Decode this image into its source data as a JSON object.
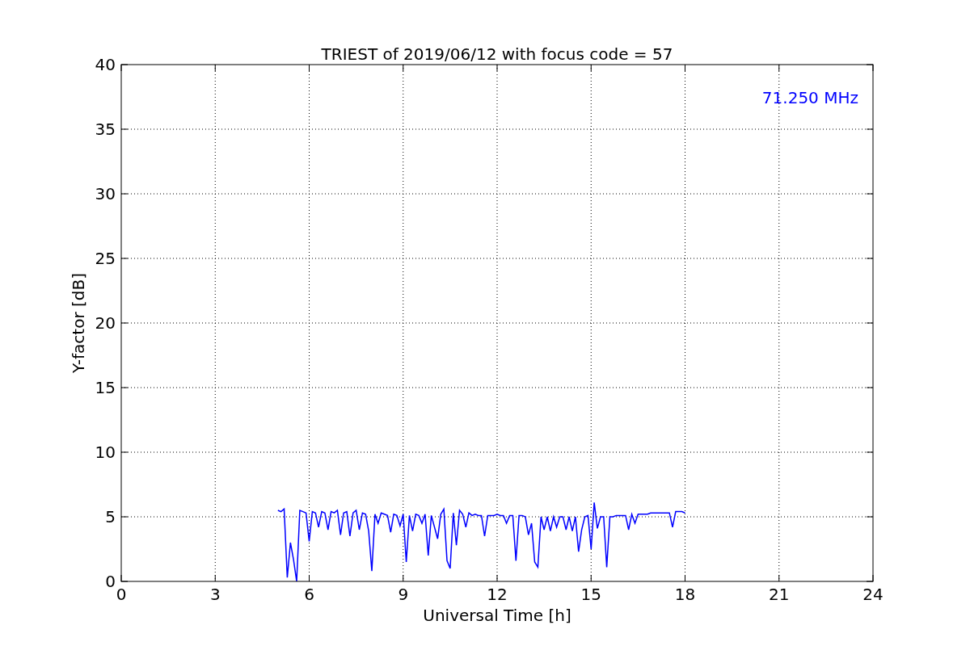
{
  "chart_data": {
    "type": "line",
    "title": "TRIEST of 2019/06/12 with focus code = 57",
    "xlabel": "Universal Time [h]",
    "ylabel": "Y-factor [dB]",
    "xlim": [
      0,
      24
    ],
    "ylim": [
      0,
      40
    ],
    "xticks": [
      0,
      3,
      6,
      9,
      12,
      15,
      18,
      21,
      24
    ],
    "yticks": [
      0,
      5,
      10,
      15,
      20,
      25,
      30,
      35,
      40
    ],
    "grid": true,
    "x": [
      5.0,
      5.1,
      5.2,
      5.3,
      5.4,
      5.5,
      5.6,
      5.7,
      5.8,
      5.9,
      6.0,
      6.1,
      6.2,
      6.3,
      6.4,
      6.5,
      6.6,
      6.7,
      6.8,
      6.9,
      7.0,
      7.1,
      7.2,
      7.3,
      7.4,
      7.5,
      7.6,
      7.7,
      7.8,
      7.9,
      8.0,
      8.1,
      8.2,
      8.3,
      8.4,
      8.5,
      8.6,
      8.7,
      8.8,
      8.9,
      9.0,
      9.1,
      9.2,
      9.3,
      9.4,
      9.5,
      9.6,
      9.7,
      9.8,
      9.9,
      10.0,
      10.1,
      10.2,
      10.3,
      10.4,
      10.5,
      10.6,
      10.7,
      10.8,
      10.9,
      11.0,
      11.1,
      11.2,
      11.3,
      11.4,
      11.5,
      11.6,
      11.7,
      11.8,
      11.9,
      12.0,
      12.1,
      12.2,
      12.3,
      12.4,
      12.5,
      12.6,
      12.7,
      12.8,
      12.9,
      13.0,
      13.1,
      13.2,
      13.3,
      13.4,
      13.5,
      13.6,
      13.7,
      13.8,
      13.9,
      14.0,
      14.1,
      14.2,
      14.3,
      14.4,
      14.5,
      14.6,
      14.7,
      14.8,
      14.9,
      15.0,
      15.1,
      15.2,
      15.3,
      15.4,
      15.5,
      15.6,
      15.7,
      15.8,
      15.9,
      16.0,
      16.1,
      16.2,
      16.3,
      16.4,
      16.5,
      16.6,
      16.7,
      16.8,
      16.9,
      17.0,
      17.1,
      17.2,
      17.3,
      17.4,
      17.5,
      17.6,
      17.7,
      17.8,
      17.9,
      18.0
    ],
    "series": [
      {
        "name": "71.250 MHz",
        "color": "#0000ff",
        "values": [
          5.5,
          5.4,
          5.6,
          0.3,
          3.0,
          1.7,
          0.0,
          5.5,
          5.4,
          5.3,
          3.1,
          5.4,
          5.3,
          4.2,
          5.4,
          5.3,
          4.0,
          5.4,
          5.3,
          5.5,
          3.6,
          5.3,
          5.4,
          3.5,
          5.3,
          5.5,
          4.0,
          5.3,
          5.2,
          3.9,
          0.8,
          5.2,
          4.5,
          5.3,
          5.2,
          5.1,
          3.8,
          5.2,
          5.1,
          4.3,
          5.2,
          1.5,
          5.1,
          3.9,
          5.2,
          5.1,
          4.5,
          5.2,
          2.0,
          5.1,
          4.2,
          3.3,
          5.2,
          5.6,
          1.6,
          1.0,
          5.3,
          2.8,
          5.5,
          5.2,
          4.2,
          5.3,
          5.1,
          5.2,
          5.1,
          5.1,
          3.5,
          5.1,
          5.1,
          5.1,
          5.2,
          5.1,
          5.1,
          4.5,
          5.1,
          5.1,
          1.6,
          5.1,
          5.1,
          5.0,
          3.6,
          4.5,
          1.5,
          1.1,
          5.0,
          4.0,
          5.0,
          3.9,
          5.0,
          4.2,
          5.0,
          5.0,
          4.0,
          5.0,
          3.9,
          5.0,
          2.3,
          4.0,
          5.0,
          5.1,
          2.5,
          6.1,
          4.1,
          5.0,
          5.0,
          1.1,
          5.0,
          5.0,
          5.1,
          5.1,
          5.1,
          5.1,
          4.0,
          5.2,
          4.5,
          5.2,
          5.2,
          5.2,
          5.2,
          5.3,
          5.3,
          5.3,
          5.3,
          5.3,
          5.3,
          5.3,
          4.2,
          5.4,
          5.4,
          5.4,
          5.3
        ]
      }
    ]
  }
}
